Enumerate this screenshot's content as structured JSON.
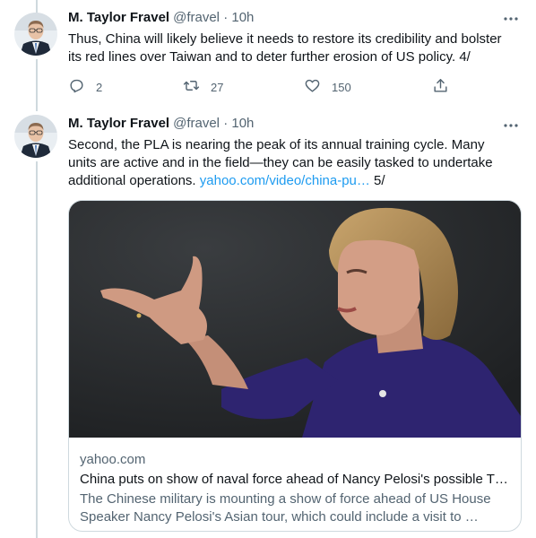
{
  "tweets": [
    {
      "author_name": "M. Taylor Fravel",
      "author_handle": "@fravel",
      "time": "· 10h",
      "text": "Thus, China will likely believe it needs to restore its credibility and bolster its red lines over Taiwan and to deter further erosion of US policy. 4/",
      "replies": "2",
      "retweets": "27",
      "likes": "150"
    },
    {
      "author_name": "M. Taylor Fravel",
      "author_handle": "@fravel",
      "time": "· 10h",
      "text_before_link": "Second, the PLA is nearing the peak of its annual training cycle. Many units are active and in the field—they can be easily tasked to undertake additional operations. ",
      "link": "yahoo.com/video/china-pu…",
      "text_after_link": " 5/",
      "card": {
        "domain": "yahoo.com",
        "title": "China puts on show of naval force ahead of Nancy Pelosi's possible T…",
        "description": "The Chinese military is mounting a show of force ahead of US House Speaker Nancy Pelosi's Asian tour, which could include a visit to …"
      }
    }
  ],
  "colors": {
    "text": "#0f1419",
    "secondary": "#536471",
    "link": "#1d9bf0",
    "border": "#cfd9de"
  },
  "icons": [
    "more-icon",
    "reply-icon",
    "retweet-icon",
    "like-icon",
    "share-icon"
  ]
}
